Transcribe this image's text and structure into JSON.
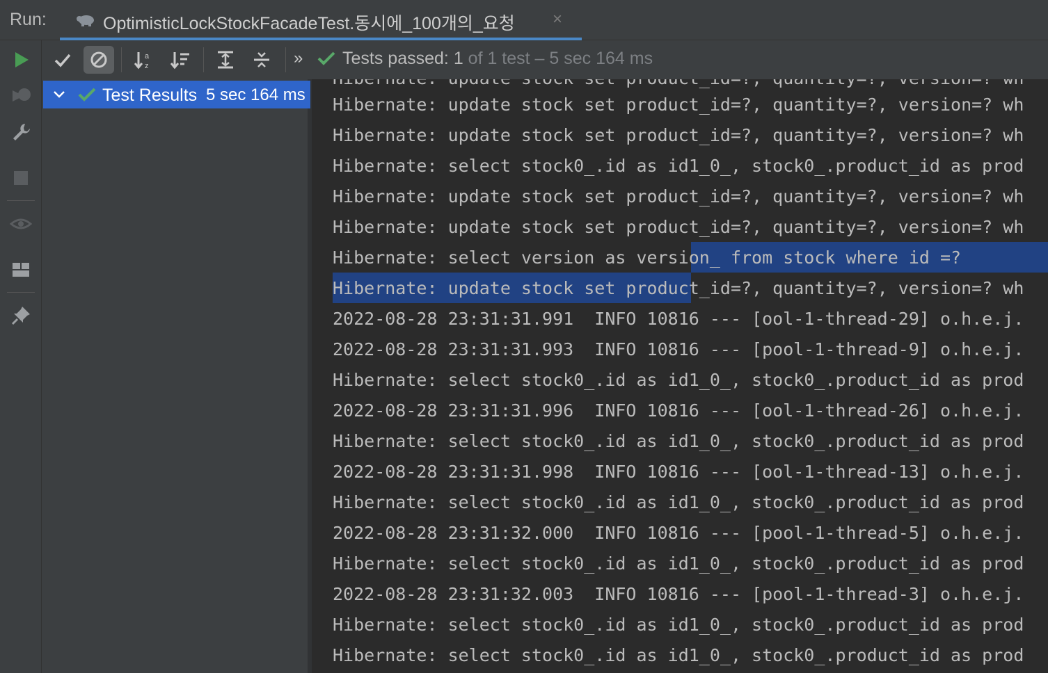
{
  "run_bar": {
    "label": "Run:",
    "tab_title": "OptimisticLockStockFacadeTest.동시에_100개의_요청",
    "close_glyph": "×"
  },
  "left_toolbar": {
    "icons": [
      "rerun-icon",
      "rerun-failed-icon",
      "wrench-icon",
      "stop-icon",
      "eye-icon",
      "layout-icon",
      "pin-icon"
    ]
  },
  "test_toolbar": {
    "icons": [
      "show-passed-icon",
      "show-ignored-icon",
      "sort-alpha-icon",
      "sort-duration-icon",
      "expand-all-icon",
      "collapse-all-icon",
      "more-icon"
    ],
    "more_glyph": "»",
    "status_prefix": "Tests passed: ",
    "status_passed": "1",
    "status_rest": " of 1 test – 5 sec 164 ms"
  },
  "tree": {
    "root_label": "Test Results",
    "root_time": "5 sec 164 ms"
  },
  "console": {
    "partial_top_line": "Hibernate: update stock set product_id=?, quantity=?, version=? wh",
    "lines": [
      "Hibernate: update stock set product_id=?, quantity=?, version=? wh",
      "Hibernate: update stock set product_id=?, quantity=?, version=? wh",
      "Hibernate: select stock0_.id as id1_0_, stock0_.product_id as prod",
      "Hibernate: update stock set product_id=?, quantity=?, version=? wh",
      "Hibernate: update stock set product_id=?, quantity=?, version=? wh",
      "Hibernate: select version as version_ from stock where id =?",
      "Hibernate: update stock set product_id=?, quantity=?, version=? wh",
      "2022-08-28 23:31:31.991  INFO 10816 --- [ool-1-thread-29] o.h.e.j.",
      "2022-08-28 23:31:31.993  INFO 10816 --- [pool-1-thread-9] o.h.e.j.",
      "Hibernate: select stock0_.id as id1_0_, stock0_.product_id as prod",
      "2022-08-28 23:31:31.996  INFO 10816 --- [ool-1-thread-26] o.h.e.j.",
      "Hibernate: select stock0_.id as id1_0_, stock0_.product_id as prod",
      "2022-08-28 23:31:31.998  INFO 10816 --- [ool-1-thread-13] o.h.e.j.",
      "Hibernate: select stock0_.id as id1_0_, stock0_.product_id as prod",
      "2022-08-28 23:31:32.000  INFO 10816 --- [pool-1-thread-5] o.h.e.j.",
      "Hibernate: select stock0_.id as id1_0_, stock0_.product_id as prod",
      "2022-08-28 23:31:32.003  INFO 10816 --- [pool-1-thread-3] o.h.e.j.",
      "Hibernate: select stock0_.id as id1_0_, stock0_.product_id as prod",
      "Hibernate: select stock0_.id as id1_0_, stock0_.product_id as prod"
    ]
  },
  "colors": {
    "accent": "#4a88c7",
    "selection": "#214283",
    "tree_selection": "#2f65ca",
    "pass_green": "#59a869",
    "panel": "#3c3f41",
    "editor_bg": "#2b2b2b"
  }
}
